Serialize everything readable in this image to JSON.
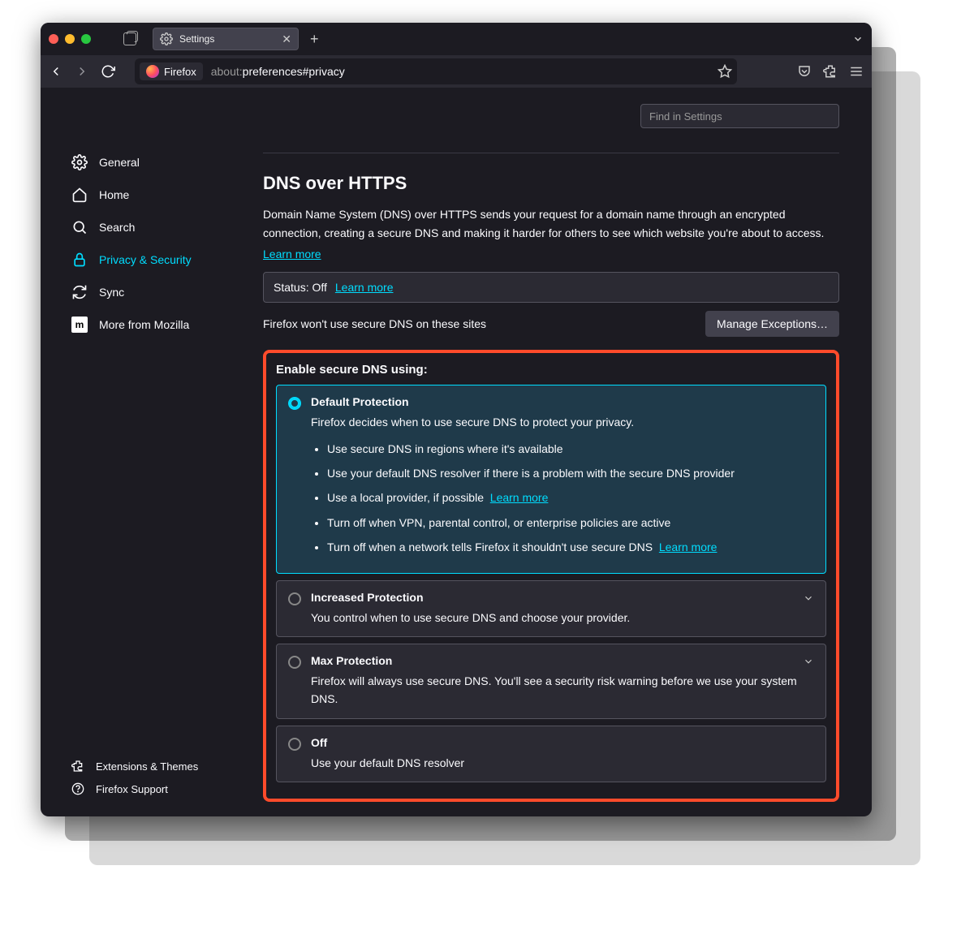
{
  "tab": {
    "title": "Settings"
  },
  "urlbar": {
    "badge": "Firefox",
    "url_prefix": "about:",
    "url_rest": "preferences#privacy"
  },
  "sidebar": {
    "items": [
      {
        "label": "General"
      },
      {
        "label": "Home"
      },
      {
        "label": "Search"
      },
      {
        "label": "Privacy & Security"
      },
      {
        "label": "Sync"
      },
      {
        "label": "More from Mozilla"
      }
    ],
    "bottom": [
      {
        "label": "Extensions & Themes"
      },
      {
        "label": "Firefox Support"
      }
    ]
  },
  "search": {
    "placeholder": "Find in Settings"
  },
  "dns": {
    "title": "DNS over HTTPS",
    "desc": "Domain Name System (DNS) over HTTPS sends your request for a domain name through an encrypted connection, creating a secure DNS and making it harder for others to see which website you're about to access.",
    "learn_more": "Learn more",
    "status_label": "Status: Off",
    "status_learn": "Learn more",
    "exceptions_text": "Firefox won't use secure DNS on these sites",
    "manage_btn": "Manage Exceptions…",
    "enable_title": "Enable secure DNS using:",
    "options": [
      {
        "title": "Default Protection",
        "desc": "Firefox decides when to use secure DNS to protect your privacy.",
        "bullets": [
          "Use secure DNS in regions where it's available",
          "Use your default DNS resolver if there is a problem with the secure DNS provider",
          "Use a local provider, if possible",
          "Turn off when VPN, parental control, or enterprise policies are active",
          "Turn off when a network tells Firefox it shouldn't use secure DNS"
        ],
        "bullet_learn_2": "Learn more",
        "bullet_learn_4": "Learn more"
      },
      {
        "title": "Increased Protection",
        "desc": "You control when to use secure DNS and choose your provider."
      },
      {
        "title": "Max Protection",
        "desc": "Firefox will always use secure DNS. You'll see a security risk warning before we use your system DNS."
      },
      {
        "title": "Off",
        "desc": "Use your default DNS resolver"
      }
    ]
  }
}
